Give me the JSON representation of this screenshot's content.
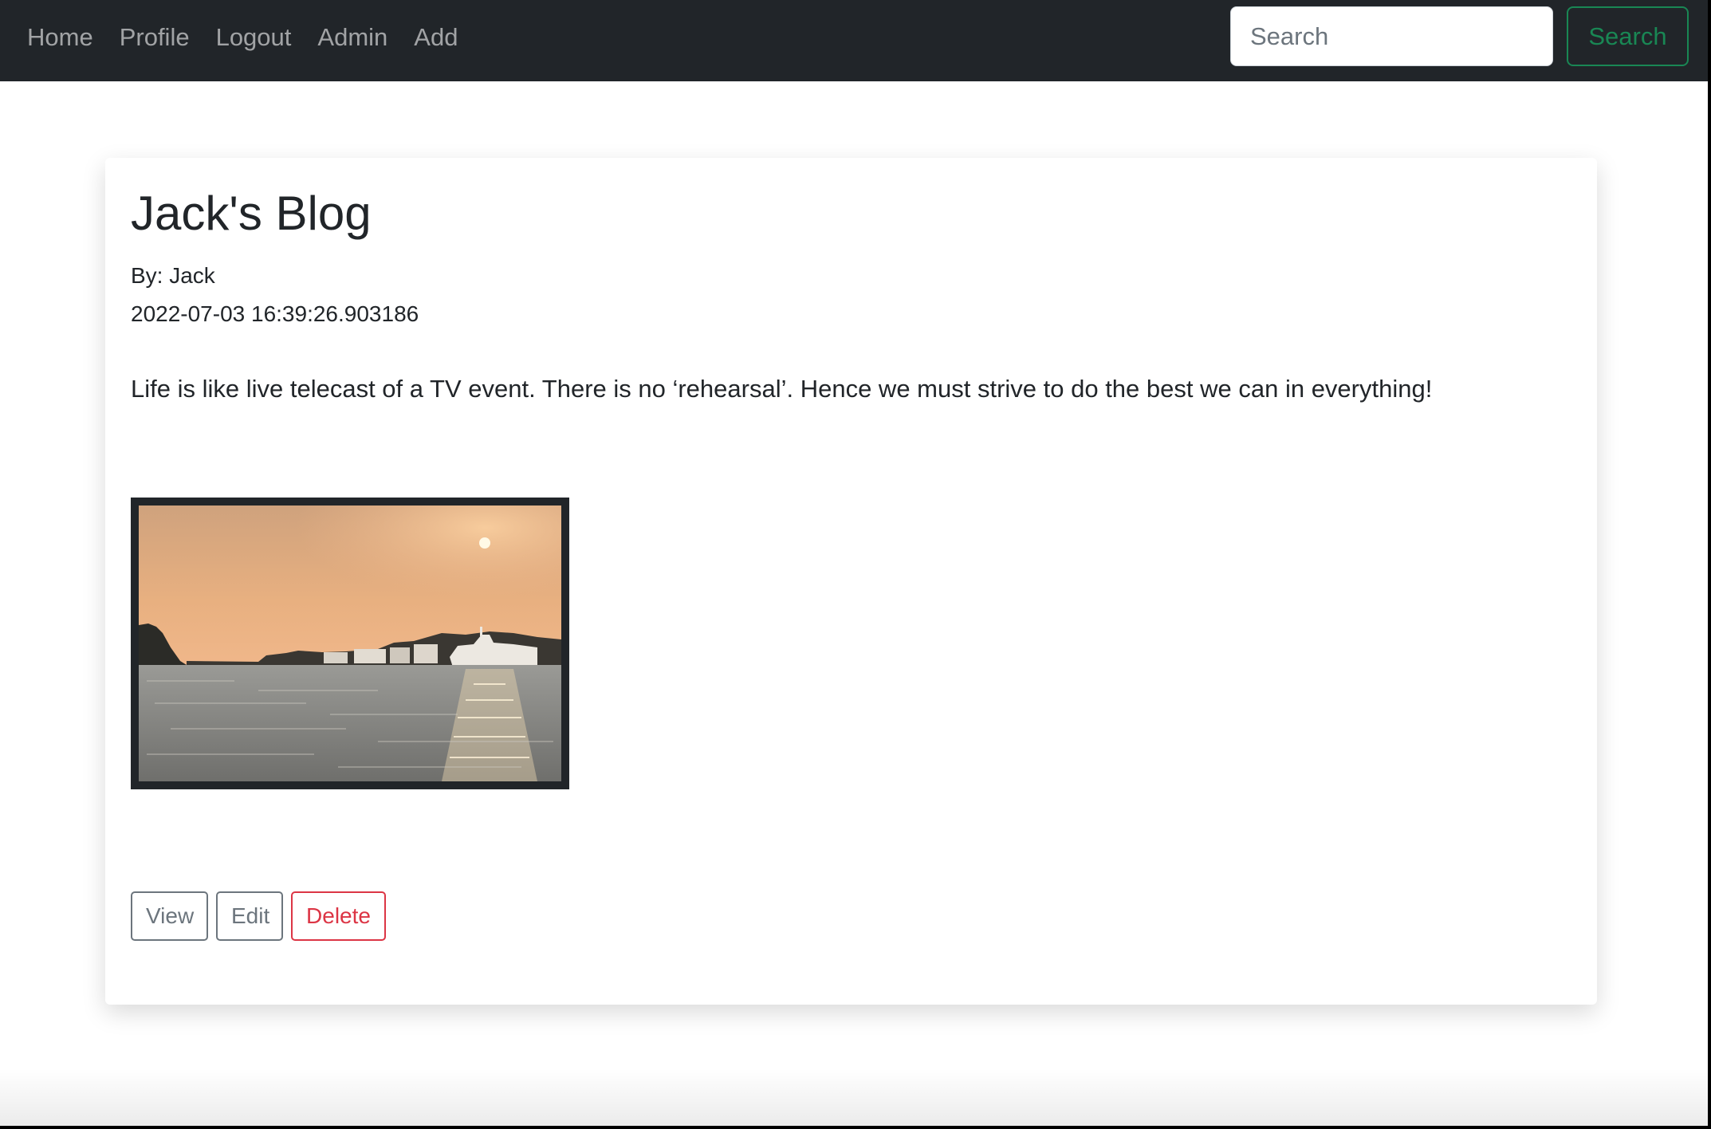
{
  "navbar": {
    "links": [
      "Home",
      "Profile",
      "Logout",
      "Admin",
      "Add"
    ],
    "search_placeholder": "Search",
    "search_value": "",
    "search_button_label": "Search"
  },
  "post": {
    "title": "Jack's Blog",
    "author_line": "By: Jack",
    "timestamp": "2022-07-03 16:39:26.903186",
    "content": "Life is like live telecast of a TV event. There is no ‘rehearsal’. Hence we must strive to do the best we can in everything!",
    "image_description": "sunset-over-harbor-photo"
  },
  "actions": {
    "view_label": "View",
    "edit_label": "Edit",
    "delete_label": "Delete"
  },
  "colors": {
    "navbar_bg": "#212529",
    "search_button": "#198754",
    "delete_button": "#dc3545",
    "secondary_button": "#6c757d"
  }
}
